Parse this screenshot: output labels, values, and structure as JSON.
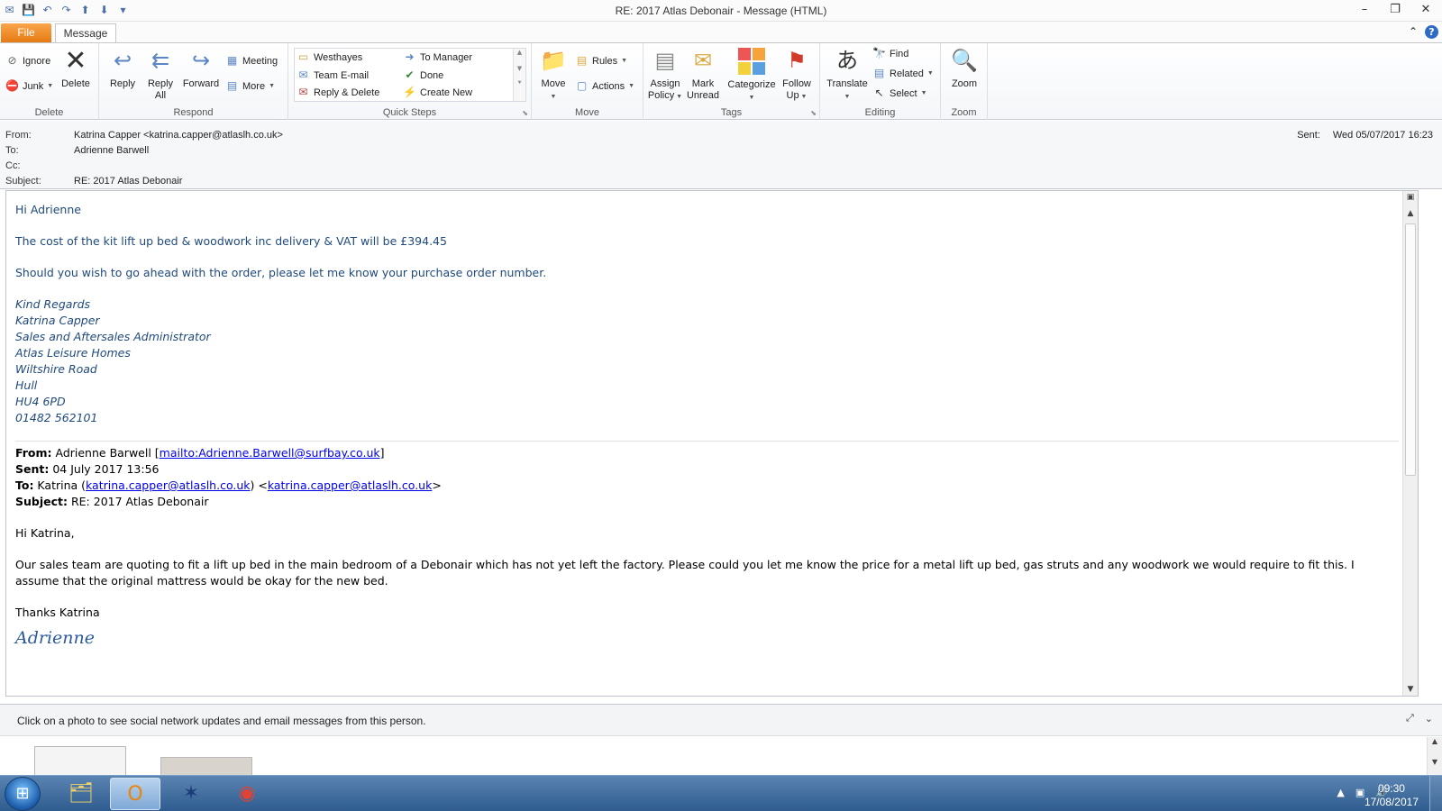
{
  "window": {
    "title": "RE: 2017 Atlas Debonair - Message (HTML)"
  },
  "tabs": {
    "file": "File",
    "message": "Message"
  },
  "ribbon": {
    "delete_group": {
      "label": "Delete",
      "ignore": "Ignore",
      "junk": "Junk",
      "delete": "Delete"
    },
    "respond_group": {
      "label": "Respond",
      "reply": "Reply",
      "reply_all_1": "Reply",
      "reply_all_2": "All",
      "forward": "Forward",
      "meeting": "Meeting",
      "more": "More"
    },
    "quick_steps": {
      "label": "Quick Steps",
      "items": [
        "Westhayes",
        "Team E-mail",
        "Reply & Delete",
        "To Manager",
        "Done",
        "Create New"
      ]
    },
    "move_group": {
      "label": "Move",
      "move": "Move",
      "rules": "Rules",
      "actions": "Actions"
    },
    "tags_group": {
      "label": "Tags",
      "assign_policy_1": "Assign",
      "assign_policy_2": "Policy",
      "mark_unread_1": "Mark",
      "mark_unread_2": "Unread",
      "categorize": "Categorize",
      "follow_up_1": "Follow",
      "follow_up_2": "Up"
    },
    "editing_group": {
      "label": "Editing",
      "translate": "Translate",
      "find": "Find",
      "related": "Related",
      "select": "Select"
    },
    "zoom_group": {
      "label": "Zoom",
      "zoom": "Zoom"
    }
  },
  "header": {
    "from_label": "From:",
    "from_value": "Katrina Capper <katrina.capper@atlaslh.co.uk>",
    "to_label": "To:",
    "to_value": "Adrienne Barwell",
    "cc_label": "Cc:",
    "cc_value": "",
    "subject_label": "Subject:",
    "subject_value": "RE: 2017 Atlas Debonair",
    "sent_label": "Sent:",
    "sent_value": "Wed 05/07/2017 16:23"
  },
  "body": {
    "greeting": "Hi Adrienne",
    "line1": "The cost of the kit lift up bed & woodwork inc delivery & VAT will be £394.45",
    "line2": "Should you wish to go ahead with the order, please let me know your purchase order number.",
    "signature": [
      "Kind Regards",
      "Katrina Capper",
      "Sales and Aftersales Administrator",
      "Atlas Leisure Homes",
      "Wiltshire Road",
      "Hull",
      "HU4 6PD",
      "01482 562101"
    ],
    "quoted": {
      "from_label": "From:",
      "from_name": " Adrienne Barwell [",
      "from_link": "mailto:Adrienne.Barwell@surfbay.co.uk",
      "from_end": "]",
      "sent_label": "Sent:",
      "sent_value": " 04 July 2017 13:56",
      "to_label": "To:",
      "to_name": " Katrina (",
      "to_link1": "katrina.capper@atlaslh.co.uk",
      "to_mid": ") <",
      "to_link2": "katrina.capper@atlaslh.co.uk",
      "to_end": ">",
      "subject_label": "Subject:",
      "subject_value": " RE: 2017 Atlas Debonair",
      "greeting": "Hi Katrina,",
      "paragraph": "Our sales team are quoting to fit a lift up bed in the main bedroom of a Debonair  which has not yet left the factory.  Please could you let me know the price for a metal lift up bed, gas struts  and any woodwork we would require to fit this.  I assume that the original mattress would be okay for the new bed.",
      "thanks": "Thanks Katrina",
      "script_signature": "Adrienne"
    }
  },
  "people_pane": {
    "text": "Click on a photo to see social network updates and email messages from this person."
  },
  "taskbar": {
    "time": "09:30",
    "date": "17/08/2017"
  },
  "colors": {
    "file_tab": "#e57a12",
    "body_text": "#1f497d",
    "link": "#0000ee",
    "taskbar": "#2f5c8f"
  }
}
